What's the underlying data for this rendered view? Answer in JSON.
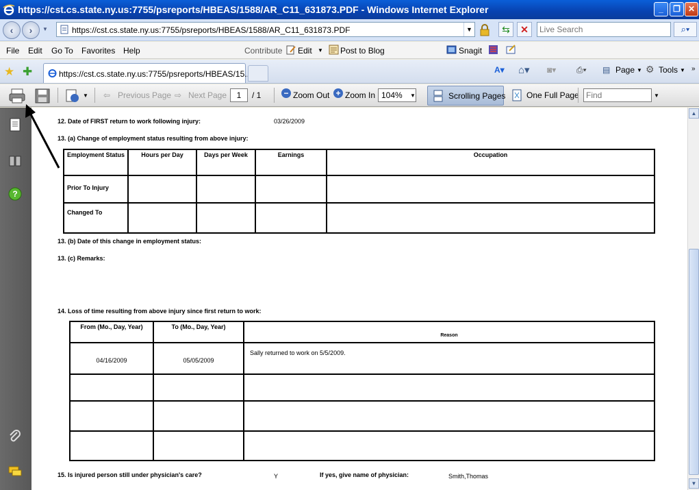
{
  "window": {
    "title": "https://cst.cs.state.ny.us:7755/psreports/HBEAS/1588/AR_C11_631873.PDF - Windows Internet Explorer"
  },
  "address_bar": {
    "url": "https://cst.cs.state.ny.us:7755/psreports/HBEAS/1588/AR_C11_631873.PDF",
    "search_placeholder": "Live Search"
  },
  "menu": {
    "items": [
      "File",
      "Edit",
      "Go To",
      "Favorites",
      "Help"
    ],
    "contribute": "Contribute",
    "edit_btn": "Edit",
    "post_to_blog": "Post to Blog",
    "snagit": "Snagit"
  },
  "tabs": {
    "active_tab_label": "https://cst.cs.state.ny.us:7755/psreports/HBEAS/15...",
    "page_label": "Page",
    "tools_label": "Tools"
  },
  "pdf_toolbar": {
    "previous_page": "Previous Page",
    "next_page": "Next Page",
    "page_current": "1",
    "page_total": "/  1",
    "zoom_out": "Zoom Out",
    "zoom_in": "Zoom In",
    "zoom_level": "104%",
    "scrolling_pages": "Scrolling Pages",
    "one_full_page": "One Full Page",
    "find_placeholder": "Find"
  },
  "document": {
    "q12_label": "12.  Date of FIRST return to work following injury:",
    "q12_value": "03/26/2009",
    "q13a_label": "13.  (a)  Change of employment status resulting from above injury:",
    "employment_table": {
      "headers": [
        "Employment Status",
        "Hours per Day",
        "Days per Week",
        "Earnings",
        "Occupation"
      ],
      "rows": [
        "Prior To Injury",
        "Changed To"
      ]
    },
    "q13b_label": "13.  (b)  Date of this change in employment status:",
    "q13c_label": "13.  (c)  Remarks:",
    "q14_label": "14.  Loss of time resulting from above injury since first return to work:",
    "loss_table": {
      "headers": [
        "From (Mo., Day, Year)",
        "To (Mo., Day, Year)",
        "Reason"
      ],
      "rows": [
        {
          "from": "04/16/2009",
          "to": "05/05/2009",
          "reason": "Sally returned to work on 5/5/2009."
        },
        {
          "from": "",
          "to": "",
          "reason": ""
        },
        {
          "from": "",
          "to": "",
          "reason": ""
        },
        {
          "from": "",
          "to": "",
          "reason": ""
        }
      ]
    },
    "q15_label": "15.  Is injured person still under physician's care?",
    "q15_value": "Y",
    "q15_followup": "If yes, give name of physician:",
    "q15_physician": "Smith,Thomas"
  },
  "icons": {
    "ie_logo": "ie-logo-icon",
    "print": "print-icon",
    "save": "save-icon",
    "arrow_annotation": "annotation-arrow"
  }
}
